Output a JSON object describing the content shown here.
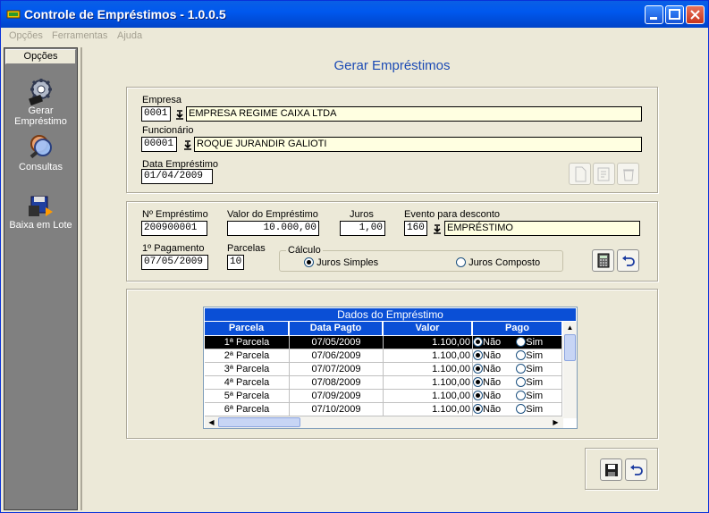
{
  "window": {
    "title": "Controle de Empréstimos - 1.0.0.5"
  },
  "menu": [
    "Opções",
    "Ferramentas",
    "Ajuda"
  ],
  "sidebar": {
    "header": "Opções",
    "items": [
      {
        "label_line1": "Gerar",
        "label_line2": "Empréstimo",
        "icon": "gear-icon"
      },
      {
        "label_line1": "Consultas",
        "icon": "magnifier-icon"
      },
      {
        "label_line1": "Baixa em Lote",
        "icon": "batch-icon"
      }
    ]
  },
  "main": {
    "heading": "Gerar Empréstimos"
  },
  "empresa": {
    "label": "Empresa",
    "code": "0001",
    "name": "EMPRESA REGIME CAIXA LTDA"
  },
  "funcionario": {
    "label": "Funcionário",
    "code": "00001",
    "name": "ROQUE JURANDIR GALIOTI"
  },
  "data_emprestimo": {
    "label": "Data Empréstimo",
    "value": "01/04/2009"
  },
  "loan": {
    "numero_label": "Nº Empréstimo",
    "numero": "200900001",
    "valor_label": "Valor do Empréstimo",
    "valor": "10.000,00",
    "juros_label": "Juros",
    "juros": "1,00",
    "evento_label": "Evento para desconto",
    "evento_code": "160",
    "evento_name": "EMPRÉSTIMO",
    "pagamento_label": "1º Pagamento",
    "pagamento": "07/05/2009",
    "parcelas_label": "Parcelas",
    "parcelas": "10",
    "calculo_label": "Cálculo",
    "juros_simples": "Juros Simples",
    "juros_composto": "Juros Composto",
    "selected_calc": "Juros Simples"
  },
  "grid": {
    "title": "Dados do Empréstimo",
    "columns": [
      "Parcela",
      "Data Pagto",
      "Valor",
      "Pago"
    ],
    "rows": [
      {
        "parcela": "1ª Parcela",
        "data": "07/05/2009",
        "valor": "1.100,00",
        "pago": "Não"
      },
      {
        "parcela": "2ª Parcela",
        "data": "07/06/2009",
        "valor": "1.100,00",
        "pago": "Não"
      },
      {
        "parcela": "3ª Parcela",
        "data": "07/07/2009",
        "valor": "1.100,00",
        "pago": "Não"
      },
      {
        "parcela": "4ª Parcela",
        "data": "07/08/2009",
        "valor": "1.100,00",
        "pago": "Não"
      },
      {
        "parcela": "5ª Parcela",
        "data": "07/09/2009",
        "valor": "1.100,00",
        "pago": "Não"
      },
      {
        "parcela": "6ª Parcela",
        "data": "07/10/2009",
        "valor": "1.100,00",
        "pago": "Não"
      }
    ],
    "opt_nao": "Não",
    "opt_sim": "Sim"
  },
  "colors": {
    "accent": "#0a4fd6",
    "heading": "#1c4bb5",
    "field_highlight": "#ffffe1"
  }
}
